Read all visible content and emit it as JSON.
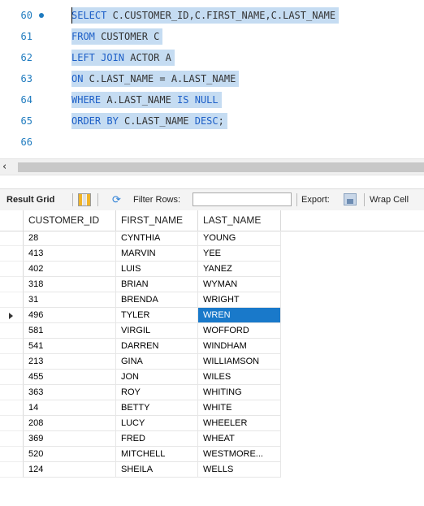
{
  "editor": {
    "lines": [
      {
        "num": "60",
        "parts": [
          {
            "t": "SELECT",
            "k": 1
          },
          {
            "t": " C.CUSTOMER_ID,C.FIRST_NAME,C.LAST_NAME",
            "k": 0
          }
        ]
      },
      {
        "num": "61",
        "parts": [
          {
            "t": "FROM",
            "k": 1
          },
          {
            "t": " CUSTOMER C",
            "k": 0
          }
        ]
      },
      {
        "num": "62",
        "parts": [
          {
            "t": "LEFT JOIN",
            "k": 1
          },
          {
            "t": " ACTOR A",
            "k": 0
          }
        ]
      },
      {
        "num": "63",
        "parts": [
          {
            "t": "ON",
            "k": 1
          },
          {
            "t": " C.LAST_NAME = A.LAST_NAME",
            "k": 0
          }
        ]
      },
      {
        "num": "64",
        "parts": [
          {
            "t": "WHERE",
            "k": 1
          },
          {
            "t": " A.LAST_NAME ",
            "k": 0
          },
          {
            "t": "IS NULL",
            "k": 1
          }
        ]
      },
      {
        "num": "65",
        "parts": [
          {
            "t": "ORDER BY",
            "k": 1
          },
          {
            "t": " C.LAST_NAME ",
            "k": 0
          },
          {
            "t": "DESC",
            "k": 1
          },
          {
            "t": ";",
            "k": 0
          }
        ]
      },
      {
        "num": "66",
        "parts": []
      }
    ]
  },
  "toolbar": {
    "result_grid_label": "Result Grid",
    "filter_rows_label": "Filter Rows:",
    "filter_value": "",
    "export_label": "Export:",
    "wrap_label": "Wrap Cell"
  },
  "grid": {
    "columns": [
      "CUSTOMER_ID",
      "FIRST_NAME",
      "LAST_NAME"
    ],
    "rows": [
      [
        "28",
        "CYNTHIA",
        "YOUNG"
      ],
      [
        "413",
        "MARVIN",
        "YEE"
      ],
      [
        "402",
        "LUIS",
        "YANEZ"
      ],
      [
        "318",
        "BRIAN",
        "WYMAN"
      ],
      [
        "31",
        "BRENDA",
        "WRIGHT"
      ],
      [
        "496",
        "TYLER",
        "WREN"
      ],
      [
        "581",
        "VIRGIL",
        "WOFFORD"
      ],
      [
        "541",
        "DARREN",
        "WINDHAM"
      ],
      [
        "213",
        "GINA",
        "WILLIAMSON"
      ],
      [
        "455",
        "JON",
        "WILES"
      ],
      [
        "363",
        "ROY",
        "WHITING"
      ],
      [
        "14",
        "BETTY",
        "WHITE"
      ],
      [
        "208",
        "LUCY",
        "WHEELER"
      ],
      [
        "369",
        "FRED",
        "WHEAT"
      ],
      [
        "520",
        "MITCHELL",
        "WESTMORE..."
      ],
      [
        "124",
        "SHEILA",
        "WELLS"
      ]
    ],
    "current_row_index": 5,
    "selected_cell": [
      5,
      2
    ],
    "selection_color": "#1979ca"
  },
  "colors": {
    "keyword": "#1d5fc7",
    "line_number": "#1f7bbf",
    "selection_highlight": "#c5dcf2"
  }
}
